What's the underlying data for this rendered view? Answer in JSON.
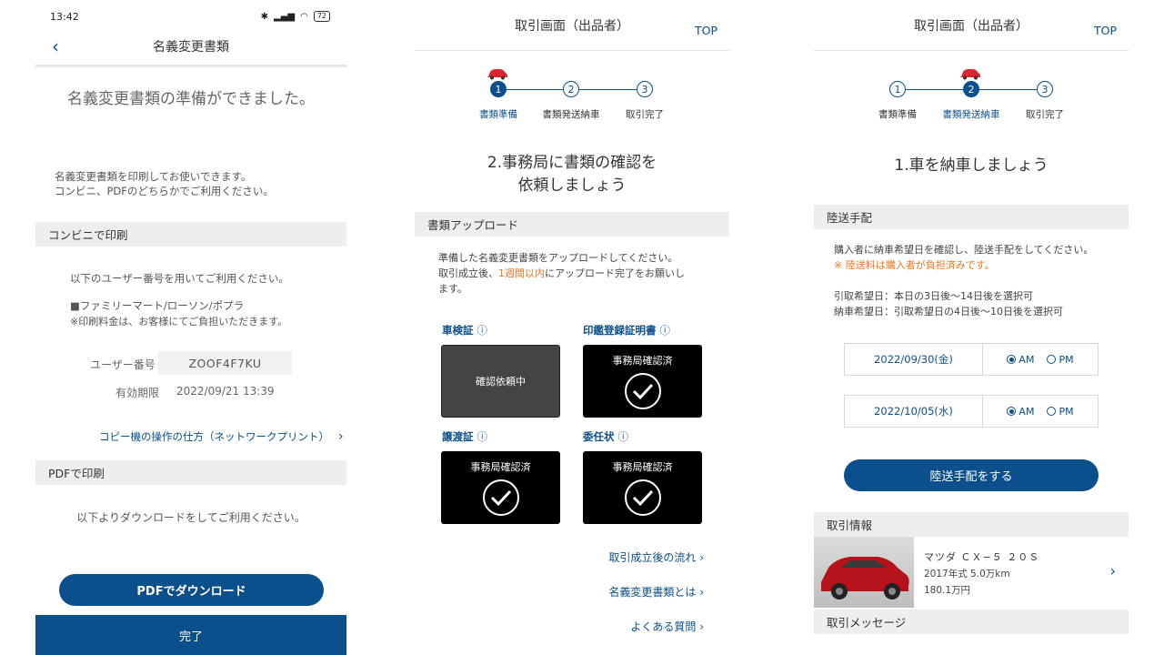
{
  "colors": {
    "brand": "#0b4f8c",
    "accent": "#e87722",
    "gray_bar": "#eeeeee"
  },
  "screen1": {
    "status_time": "13:42",
    "battery": "72",
    "title": "名義変更書類",
    "heading": "名義変更書類の準備ができました。",
    "intro_line1": "名義変更書類を印刷してお使いできます。",
    "intro_line2": "コンビニ、PDFのどちらかでご利用ください。",
    "section_convenience": "コンビニで印刷",
    "use_user_number": "以下のユーザー番号を用いてご利用ください。",
    "stores": "■ファミリーマート/ローソン/ポプラ",
    "fee_note": "※印刷料金は、お客様にてご負担いただきます。",
    "user_number_label": "ユーザー番号",
    "user_number_value": "ZOOF4F7KU",
    "expiry_label": "有効期限",
    "expiry_value": "2022/09/21 13:39",
    "copy_link": "コピー機の操作の仕方（ネットワークプリント）",
    "section_pdf": "PDFで印刷",
    "pdf_note": "以下よりダウンロードをしてご利用ください。",
    "pdf_button": "PDFでダウンロード",
    "done_button": "完了"
  },
  "screen2": {
    "title": "取引画面（出品者）",
    "top_link": "TOP",
    "steps": [
      "書類準備",
      "書類発送納車",
      "取引完了"
    ],
    "heading_line1": "2.事務局に書類の確認を",
    "heading_line2": "依頼しましょう",
    "section_upload": "書類アップロード",
    "upload_line1": "準備した名義変更書類をアップロードしてください。",
    "upload_line2_pre": "取引成立後、",
    "upload_line2_accent": "1週間以内",
    "upload_line2_post": "にアップロード完了をお願いし",
    "upload_line3": "ます。",
    "docs": [
      {
        "label": "車検証",
        "status": "確認依頼中"
      },
      {
        "label": "印鑑登録証明書",
        "status": "事務局確認済"
      },
      {
        "label": "譲渡証",
        "status": "事務局確認済"
      },
      {
        "label": "委任状",
        "status": "事務局確認済"
      }
    ],
    "links": [
      "取引成立後の流れ",
      "名義変更書類とは",
      "よくある質問"
    ]
  },
  "screen3": {
    "title": "取引画面（出品者）",
    "top_link": "TOP",
    "steps": [
      "書類準備",
      "書類発送納車",
      "取引完了"
    ],
    "heading": "1.車を納車しましょう",
    "section_transport": "陸送手配",
    "transport_line1": "購入者に納車希望日を確認し、陸送手配をしてください。",
    "transport_note": "※ 陸送料は購入者が負担済みです。",
    "pickup_line": "引取希望日：本日の3日後〜14日後を選択可",
    "delivery_line": "納車希望日：引取希望日の4日後〜10日後を選択可",
    "dates": [
      {
        "date": "2022/09/30(金)",
        "am": "AM",
        "pm": "PM"
      },
      {
        "date": "2022/10/05(水)",
        "am": "AM",
        "pm": "PM"
      }
    ],
    "transport_button": "陸送手配をする",
    "section_info": "取引情報",
    "car_name": "マツダ ＣＸ−５ ２０Ｓ",
    "car_year": "2017年式  5.0万km",
    "car_price": "180.1万円",
    "section_message": "取引メッセージ"
  }
}
